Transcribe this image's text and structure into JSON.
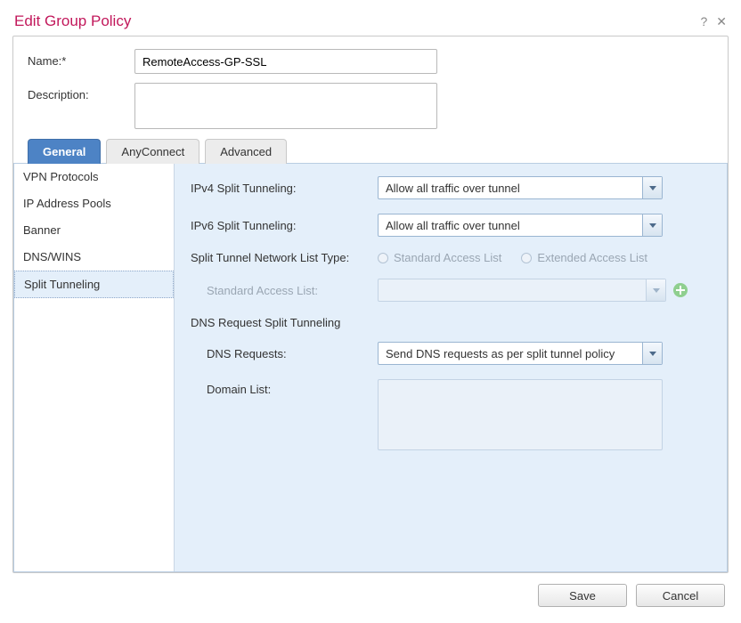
{
  "title": "Edit Group Policy",
  "fields": {
    "name_label": "Name:*",
    "name_value": "RemoteAccess-GP-SSL",
    "description_label": "Description:",
    "description_value": ""
  },
  "tabs": [
    "General",
    "AnyConnect",
    "Advanced"
  ],
  "sidenav": [
    "VPN Protocols",
    "IP Address Pools",
    "Banner",
    "DNS/WINS",
    "Split Tunneling"
  ],
  "content": {
    "ipv4_label": "IPv4 Split Tunneling:",
    "ipv4_value": "Allow all traffic over tunnel",
    "ipv6_label": "IPv6 Split Tunneling:",
    "ipv6_value": "Allow all traffic over tunnel",
    "listtype_label": "Split Tunnel Network List Type:",
    "radio_std": "Standard Access List",
    "radio_ext": "Extended Access List",
    "std_list_label": "Standard Access List:",
    "dns_section": "DNS Request Split Tunneling",
    "dns_req_label": "DNS Requests:",
    "dns_req_value": "Send DNS requests as per split tunnel policy",
    "domain_label": "Domain List:"
  },
  "buttons": {
    "save": "Save",
    "cancel": "Cancel"
  }
}
